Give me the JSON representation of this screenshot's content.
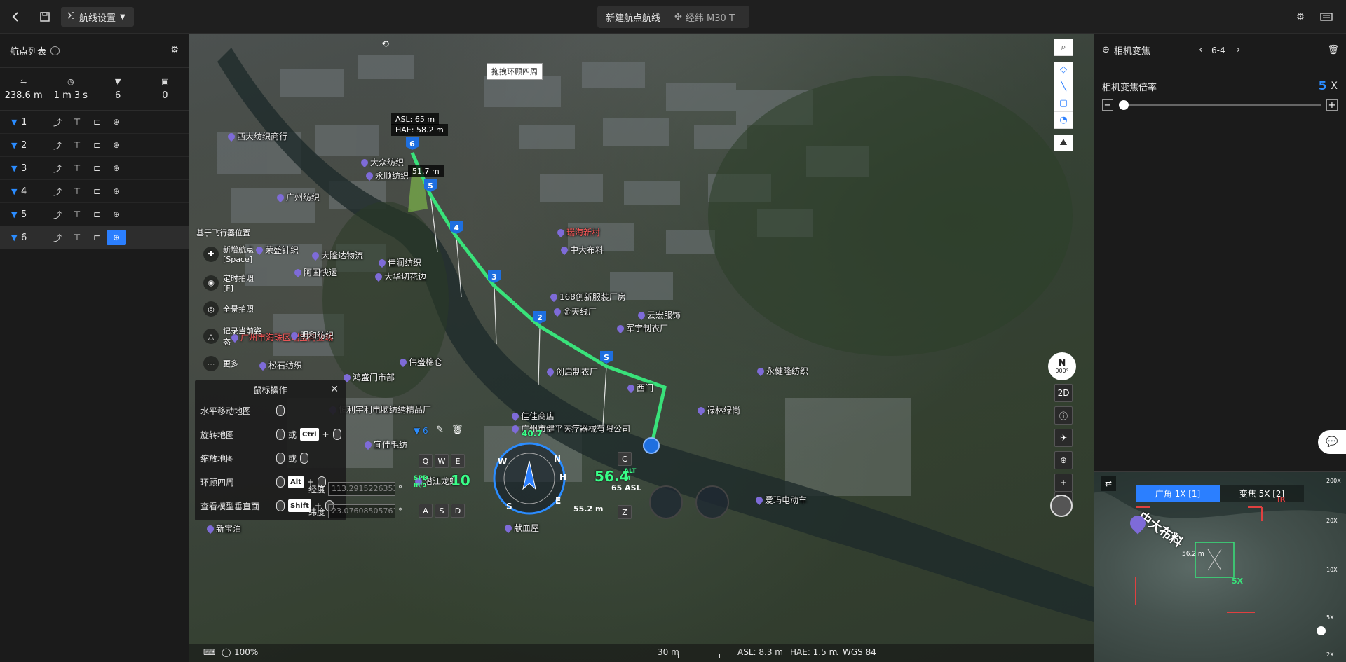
{
  "topbar": {
    "route_settings": "航线设置",
    "new_route": "新建航点航线",
    "device": "经纬 M30 T"
  },
  "left": {
    "title": "航点列表",
    "stats": [
      {
        "icon": "distance-icon",
        "value": "238.6 m"
      },
      {
        "icon": "clock-icon",
        "value": "1 m 3 s"
      },
      {
        "icon": "waypoint-count-icon",
        "value": "6"
      },
      {
        "icon": "photo-count-icon",
        "value": "0"
      }
    ],
    "waypoints": [
      {
        "num": "1"
      },
      {
        "num": "2"
      },
      {
        "num": "3"
      },
      {
        "num": "4"
      },
      {
        "num": "5"
      },
      {
        "num": "6"
      }
    ]
  },
  "map": {
    "drag_tip": "拖拽环顾四周",
    "asl": "ASL: 65 m",
    "hae": "HAE: 58.2 m",
    "seg": "51.7 m",
    "actions_title": "基于飞行器位置",
    "actions": [
      {
        "icon": "add-waypoint-icon",
        "label": "新增航点 [Space]"
      },
      {
        "icon": "camera-icon",
        "label": "定时拍照 [F]"
      },
      {
        "icon": "pano-icon",
        "label": "全景拍照"
      },
      {
        "icon": "record-pose-icon",
        "label": "记录当前姿态"
      },
      {
        "icon": "more-icon",
        "label": "更多"
      }
    ],
    "wp_markers": [
      "6",
      "5",
      "4",
      "3",
      "2",
      "S"
    ],
    "pois": [
      {
        "t": "西大纺织商行",
        "red": false
      },
      {
        "t": "大众纺织",
        "red": false
      },
      {
        "t": "永顺纺织",
        "red": false
      },
      {
        "t": "广州纺织",
        "red": false
      },
      {
        "t": "荣盛针织",
        "red": false
      },
      {
        "t": "大隆达物流",
        "red": false
      },
      {
        "t": "大华切花边",
        "red": false
      },
      {
        "t": "阿国快运",
        "red": false
      },
      {
        "t": "佳润纺织",
        "red": false
      },
      {
        "t": "广州市海珠区瑞宝商业城",
        "red": true
      },
      {
        "t": "明和纺织",
        "red": false
      },
      {
        "t": "松石纺织",
        "red": false
      },
      {
        "t": "伟盛棉仓",
        "red": false
      },
      {
        "t": "鸿盛门市部",
        "red": false
      },
      {
        "t": "恒利宇利电脑纺绣精品厂",
        "red": false
      },
      {
        "t": "佳佳商店",
        "red": false
      },
      {
        "t": "广州市健平医疗器械有限公司",
        "red": false
      },
      {
        "t": "创启制衣厂",
        "red": false
      },
      {
        "t": "西门",
        "red": false
      },
      {
        "t": "禄林绿尚",
        "red": false
      },
      {
        "t": "永健隆纺织",
        "red": false
      },
      {
        "t": "爱玛电动车",
        "red": false
      },
      {
        "t": "瑞海新村",
        "red": true
      },
      {
        "t": "中大布料",
        "red": false
      },
      {
        "t": "168创新服装厂房",
        "red": false
      },
      {
        "t": "金天线厂",
        "red": false
      },
      {
        "t": "云宏服饰",
        "red": false
      },
      {
        "t": "军宇制衣厂",
        "red": false
      },
      {
        "t": "宜佳毛纺",
        "red": false
      },
      {
        "t": "潜江龙虾",
        "red": false
      },
      {
        "t": "献血屋",
        "red": false
      },
      {
        "t": "新宝泊",
        "red": false
      }
    ],
    "mouse_ops": {
      "title": "鼠标操作",
      "rows": [
        {
          "label": "水平移动地图",
          "keys": []
        },
        {
          "label": "旋转地图",
          "keys": [
            "或",
            "Ctrl",
            "+"
          ]
        },
        {
          "label": "缩放地图",
          "keys": [
            "或"
          ]
        },
        {
          "label": "环顾四周",
          "keys": [
            "Alt",
            "+"
          ]
        },
        {
          "label": "查看模型垂直面",
          "keys": [
            "Shift",
            "+"
          ]
        }
      ]
    },
    "coords": {
      "lon_label": "经度",
      "lon": "113.29152263536",
      "lat_label": "纬度",
      "lat": "23.07608505761",
      "unit": "°"
    },
    "hud": {
      "wp": "6",
      "keys_left": [
        "Q",
        "W",
        "E",
        "A",
        "S",
        "D"
      ],
      "keys_right": [
        "C",
        "Z"
      ],
      "spd_label": "SPD m/s",
      "spd": "10",
      "alt_label": "ALT m",
      "alt": "56.4",
      "asl": "65 ASL",
      "alt_bottom": "55.2 m",
      "heading": "40.7",
      "compass": [
        "N",
        "W",
        "S",
        "E",
        "H"
      ]
    },
    "status": {
      "zoom": "100%",
      "scale": "30 m",
      "asl": "ASL: 8.3 m",
      "hae": "HAE: 1.5 m",
      "datum": "WGS 84"
    },
    "compass_label": "N",
    "compass_sub": "000°",
    "btn_2d": "2D"
  },
  "right": {
    "title": "相机变焦",
    "nav": "6-4",
    "zoom_label": "相机变焦倍率",
    "zoom_value": "5",
    "zoom_unit": "X",
    "preview": {
      "tab_wide": "广角 1X [1]",
      "tab_zoom": "变焦 5X [2]",
      "ir": "IR",
      "dist": "56.2 m",
      "zoom_box": "5X",
      "poi": "中大布料",
      "scale": [
        "200X",
        "20X",
        "10X",
        "5X",
        "2X"
      ]
    }
  },
  "colors": {
    "accent": "#2b7fff",
    "route": "#39e27a",
    "hud": "#39ff88"
  }
}
